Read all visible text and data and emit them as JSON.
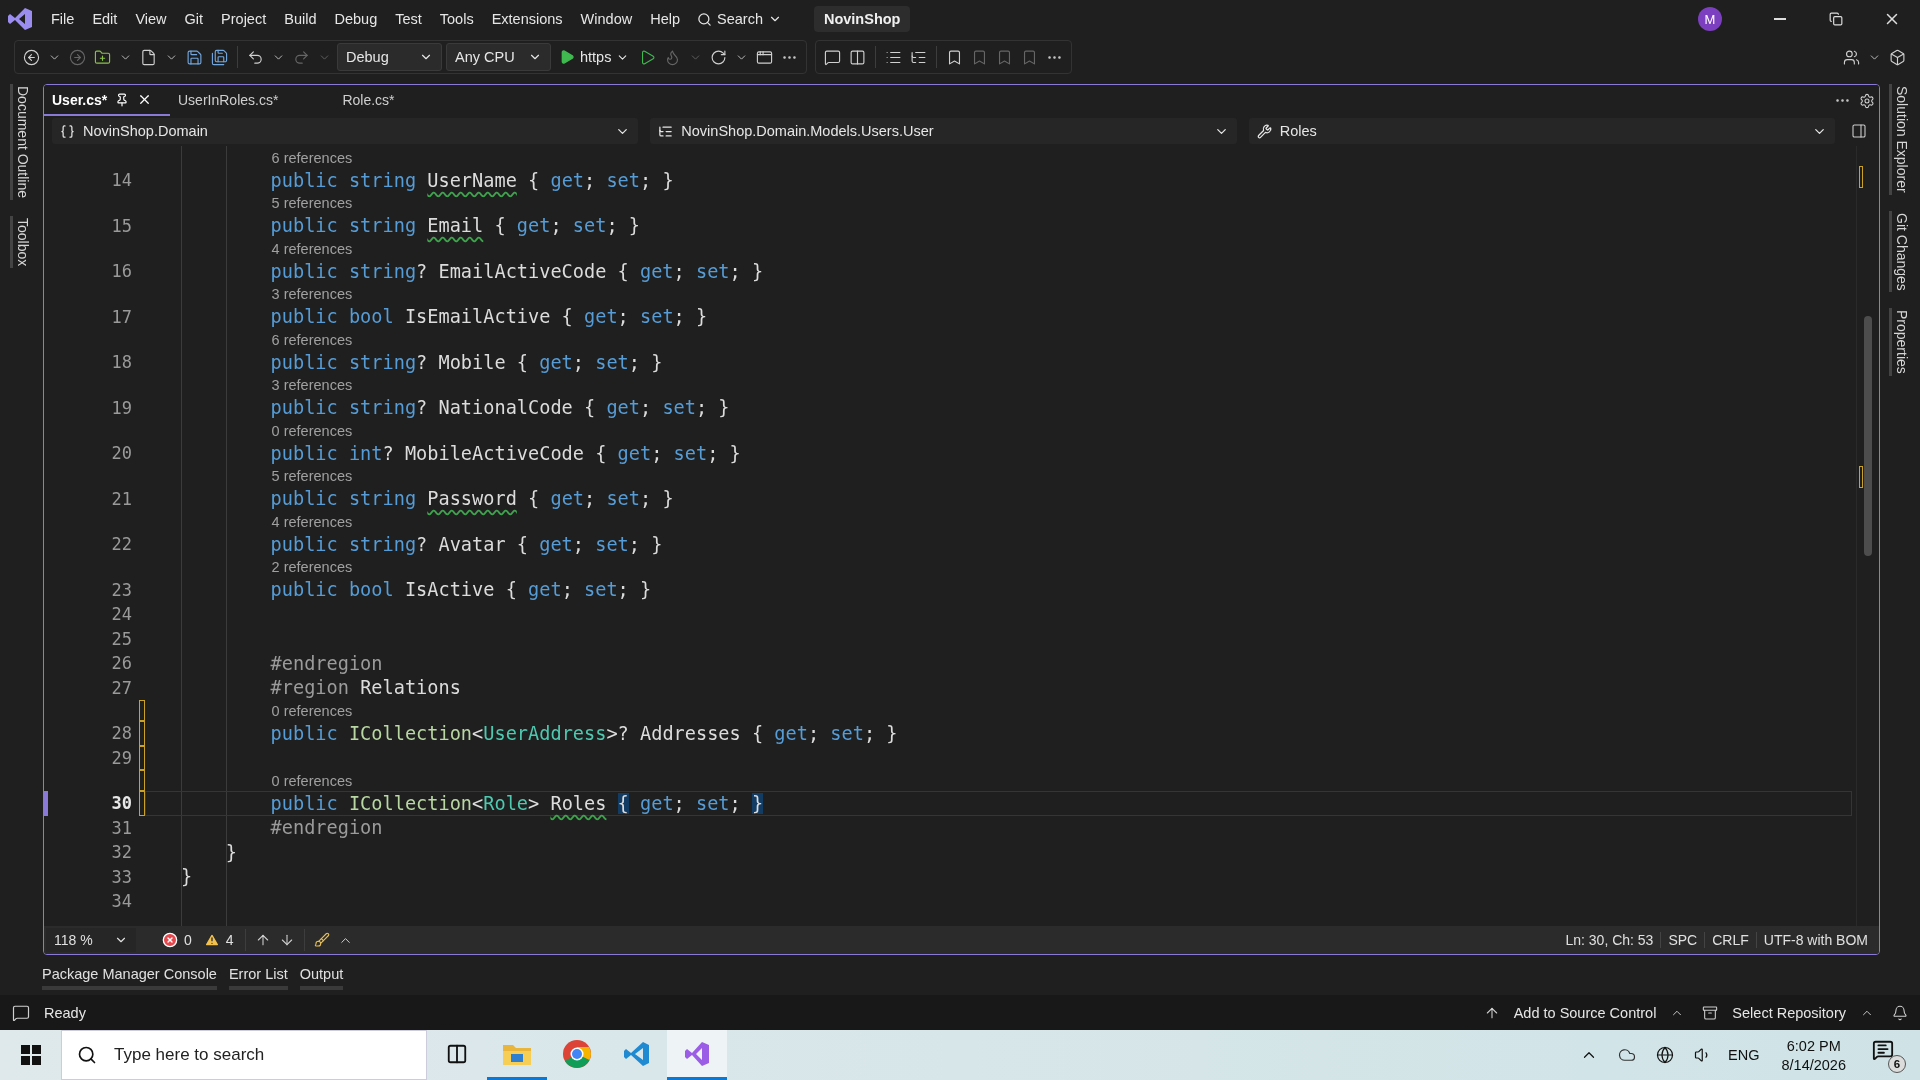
{
  "menu": {
    "items": [
      "File",
      "Edit",
      "View",
      "Git",
      "Project",
      "Build",
      "Debug",
      "Test",
      "Tools",
      "Extensions",
      "Window",
      "Help"
    ],
    "search": "Search",
    "solution": "NovinShop",
    "avatar": "M"
  },
  "toolbar": {
    "configuration": "Debug",
    "platform": "Any CPU",
    "run_target": "https"
  },
  "left_panels": [
    "Document Outline",
    "Toolbox"
  ],
  "right_panels": [
    "Solution Explorer",
    "Git Changes",
    "Properties"
  ],
  "tabs": [
    {
      "label": "User.cs*",
      "selected": true
    },
    {
      "label": "UserInRoles.cs*",
      "selected": false
    },
    {
      "label": "Role.cs*",
      "selected": false
    }
  ],
  "navigation": {
    "project": "NovinShop.Domain",
    "type": "NovinShop.Domain.Models.Users.User",
    "member": "Roles"
  },
  "lines": [
    {
      "number": "14",
      "references": "6 references",
      "changed": false,
      "current": false,
      "tokens": [
        {
          "kind": "keyword",
          "text": "        public string "
        },
        {
          "kind": "name",
          "text": "UserName",
          "squiggle": true
        },
        {
          "kind": "plain",
          "text": " { "
        },
        {
          "kind": "keyword",
          "text": "get"
        },
        {
          "kind": "plain",
          "text": "; "
        },
        {
          "kind": "keyword",
          "text": "set"
        },
        {
          "kind": "plain",
          "text": "; }"
        }
      ]
    },
    {
      "number": "15",
      "references": "5 references",
      "changed": false,
      "current": false,
      "tokens": [
        {
          "kind": "keyword",
          "text": "        public string "
        },
        {
          "kind": "name",
          "text": "Email",
          "squiggle": true
        },
        {
          "kind": "plain",
          "text": " { "
        },
        {
          "kind": "keyword",
          "text": "get"
        },
        {
          "kind": "plain",
          "text": "; "
        },
        {
          "kind": "keyword",
          "text": "set"
        },
        {
          "kind": "plain",
          "text": "; }"
        }
      ]
    },
    {
      "number": "16",
      "references": "4 references",
      "changed": false,
      "current": false,
      "tokens": [
        {
          "kind": "keyword",
          "text": "        public string"
        },
        {
          "kind": "plain",
          "text": "? EmailActiveCode { "
        },
        {
          "kind": "keyword",
          "text": "get"
        },
        {
          "kind": "plain",
          "text": "; "
        },
        {
          "kind": "keyword",
          "text": "set"
        },
        {
          "kind": "plain",
          "text": "; }"
        }
      ]
    },
    {
      "number": "17",
      "references": "3 references",
      "changed": false,
      "current": false,
      "tokens": [
        {
          "kind": "keyword",
          "text": "        public bool "
        },
        {
          "kind": "plain",
          "text": "IsEmailActive { "
        },
        {
          "kind": "keyword",
          "text": "get"
        },
        {
          "kind": "plain",
          "text": "; "
        },
        {
          "kind": "keyword",
          "text": "set"
        },
        {
          "kind": "plain",
          "text": "; }"
        }
      ]
    },
    {
      "number": "18",
      "references": "6 references",
      "changed": false,
      "current": false,
      "tokens": [
        {
          "kind": "keyword",
          "text": "        public string"
        },
        {
          "kind": "plain",
          "text": "? Mobile { "
        },
        {
          "kind": "keyword",
          "text": "get"
        },
        {
          "kind": "plain",
          "text": "; "
        },
        {
          "kind": "keyword",
          "text": "set"
        },
        {
          "kind": "plain",
          "text": "; }"
        }
      ]
    },
    {
      "number": "19",
      "references": "3 references",
      "changed": false,
      "current": false,
      "tokens": [
        {
          "kind": "keyword",
          "text": "        public string"
        },
        {
          "kind": "plain",
          "text": "? NationalCode { "
        },
        {
          "kind": "keyword",
          "text": "get"
        },
        {
          "kind": "plain",
          "text": "; "
        },
        {
          "kind": "keyword",
          "text": "set"
        },
        {
          "kind": "plain",
          "text": "; }"
        }
      ]
    },
    {
      "number": "20",
      "references": "0 references",
      "changed": false,
      "current": false,
      "tokens": [
        {
          "kind": "keyword",
          "text": "        public int"
        },
        {
          "kind": "plain",
          "text": "? MobileActiveCode { "
        },
        {
          "kind": "keyword",
          "text": "get"
        },
        {
          "kind": "plain",
          "text": "; "
        },
        {
          "kind": "keyword",
          "text": "set"
        },
        {
          "kind": "plain",
          "text": "; }"
        }
      ]
    },
    {
      "number": "21",
      "references": "5 references",
      "changed": false,
      "current": false,
      "tokens": [
        {
          "kind": "keyword",
          "text": "        public string "
        },
        {
          "kind": "name",
          "text": "Password",
          "squiggle": true
        },
        {
          "kind": "plain",
          "text": " { "
        },
        {
          "kind": "keyword",
          "text": "get"
        },
        {
          "kind": "plain",
          "text": "; "
        },
        {
          "kind": "keyword",
          "text": "set"
        },
        {
          "kind": "plain",
          "text": "; }"
        }
      ]
    },
    {
      "number": "22",
      "references": "4 references",
      "changed": false,
      "current": false,
      "tokens": [
        {
          "kind": "keyword",
          "text": "        public string"
        },
        {
          "kind": "plain",
          "text": "? Avatar { "
        },
        {
          "kind": "keyword",
          "text": "get"
        },
        {
          "kind": "plain",
          "text": "; "
        },
        {
          "kind": "keyword",
          "text": "set"
        },
        {
          "kind": "plain",
          "text": "; }"
        }
      ]
    },
    {
      "number": "23",
      "references": "2 references",
      "changed": false,
      "current": false,
      "tokens": [
        {
          "kind": "keyword",
          "text": "        public bool "
        },
        {
          "kind": "plain",
          "text": "IsActive { "
        },
        {
          "kind": "keyword",
          "text": "get"
        },
        {
          "kind": "plain",
          "text": "; "
        },
        {
          "kind": "keyword",
          "text": "set"
        },
        {
          "kind": "plain",
          "text": "; }"
        }
      ]
    },
    {
      "number": "24",
      "changed": false,
      "current": false
    },
    {
      "number": "25",
      "changed": false,
      "current": false
    },
    {
      "number": "26",
      "changed": false,
      "current": false,
      "tokens": [
        {
          "kind": "directive",
          "text": "        #endregion"
        }
      ]
    },
    {
      "number": "27",
      "changed": false,
      "current": false,
      "tokens": [
        {
          "kind": "directive",
          "text": "        #region "
        },
        {
          "kind": "plain",
          "text": "Relations"
        }
      ]
    },
    {
      "number": "28",
      "references": "0 references",
      "changed": true,
      "current": false,
      "tokens": [
        {
          "kind": "keyword",
          "text": "        public "
        },
        {
          "kind": "interface",
          "text": "ICollection"
        },
        {
          "kind": "plain",
          "text": "<"
        },
        {
          "kind": "type",
          "text": "UserAddress"
        },
        {
          "kind": "plain",
          "text": ">? Addresses { "
        },
        {
          "kind": "keyword",
          "text": "get"
        },
        {
          "kind": "plain",
          "text": "; "
        },
        {
          "kind": "keyword",
          "text": "set"
        },
        {
          "kind": "plain",
          "text": "; }"
        }
      ]
    },
    {
      "number": "29",
      "changed": true,
      "current": false
    },
    {
      "number": "30",
      "references": "0 references",
      "changed": true,
      "current": true,
      "tokens": [
        {
          "kind": "keyword",
          "text": "        public "
        },
        {
          "kind": "interface",
          "text": "ICollection"
        },
        {
          "kind": "plain",
          "text": "<"
        },
        {
          "kind": "type",
          "text": "Role"
        },
        {
          "kind": "plain",
          "text": "> "
        },
        {
          "kind": "name",
          "text": "Roles",
          "squiggle": true
        },
        {
          "kind": "plain",
          "text": "{",
          "matched": true
        },
        {
          "kind": "keyword",
          "text": " get"
        },
        {
          "kind": "plain",
          "text": "; "
        },
        {
          "kind": "keyword",
          "text": "set"
        },
        {
          "kind": "plain",
          "text": ";"
        },
        {
          "kind": "plain",
          "text": "}",
          "matched": true
        }
      ]
    },
    {
      "number": "31",
      "changed": false,
      "current": false,
      "tokens": [
        {
          "kind": "directive",
          "text": "        #endregion"
        }
      ]
    },
    {
      "number": "32",
      "changed": false,
      "current": false,
      "tokens": [
        {
          "kind": "plain",
          "text": "    }"
        }
      ]
    },
    {
      "number": "33",
      "changed": false,
      "current": false,
      "tokens": [
        {
          "kind": "plain",
          "text": "}"
        }
      ]
    },
    {
      "number": "34",
      "changed": false,
      "current": false
    }
  ],
  "editor_status": {
    "zoom": "118 %",
    "errors": "0",
    "warnings": "4",
    "position": "Ln: 30, Ch: 53",
    "whitespace": "SPC",
    "line_endings": "CRLF",
    "encoding": "UTF-8 with BOM"
  },
  "tool_tabs": [
    "Package Manager Console",
    "Error List",
    "Output"
  ],
  "status_bar": {
    "message": "Ready",
    "source_control": "Add to Source Control",
    "repository": "Select Repository"
  },
  "taskbar": {
    "search_placeholder": "Type here to search",
    "apps": [
      {
        "kind": "explorer",
        "running": true,
        "selected": false
      },
      {
        "kind": "chrome",
        "running": false,
        "selected": false
      },
      {
        "kind": "vscode",
        "running": false,
        "selected": false
      },
      {
        "kind": "visualstudio",
        "running": true,
        "selected": true
      }
    ],
    "language": "ENG",
    "time": "6:02 PM",
    "date": "8/14/2026",
    "notifications": "6"
  }
}
